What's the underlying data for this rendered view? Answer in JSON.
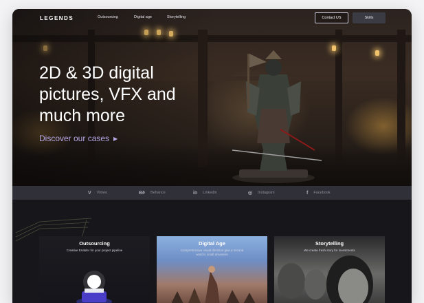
{
  "nav": {
    "logo": "LEGENDS",
    "links": [
      "Outsourcing",
      "Digital age",
      "Storytelling"
    ],
    "contact_button": "Contact US",
    "skills_button": "Skills"
  },
  "hero": {
    "headline": "2D & 3D digital pictures, VFX and much more",
    "cta": "Discover our cases"
  },
  "social": [
    {
      "label": "Vimeo",
      "icon": "vimeo-icon",
      "glyph": "V"
    },
    {
      "label": "Behance",
      "icon": "behance-icon",
      "glyph": "Bē"
    },
    {
      "label": "Linkedin",
      "icon": "linkedin-icon",
      "glyph": "in"
    },
    {
      "label": "Instagram",
      "icon": "instagram-icon",
      "glyph": "◎"
    },
    {
      "label": "Facebook",
      "icon": "facebook-icon",
      "glyph": "f"
    }
  ],
  "cards": [
    {
      "title": "Outsourcing",
      "subtitle": "Creative Enabler for your project pipeline"
    },
    {
      "title": "Digital Age",
      "subtitle": "Comprehensive visual direction give a second wind to small dreamers"
    },
    {
      "title": "Storytelling",
      "subtitle": "We create fresh story for investments"
    }
  ],
  "colors": {
    "accent": "#b8a8e6",
    "background": "#17171b",
    "social_bar": "#303038"
  }
}
